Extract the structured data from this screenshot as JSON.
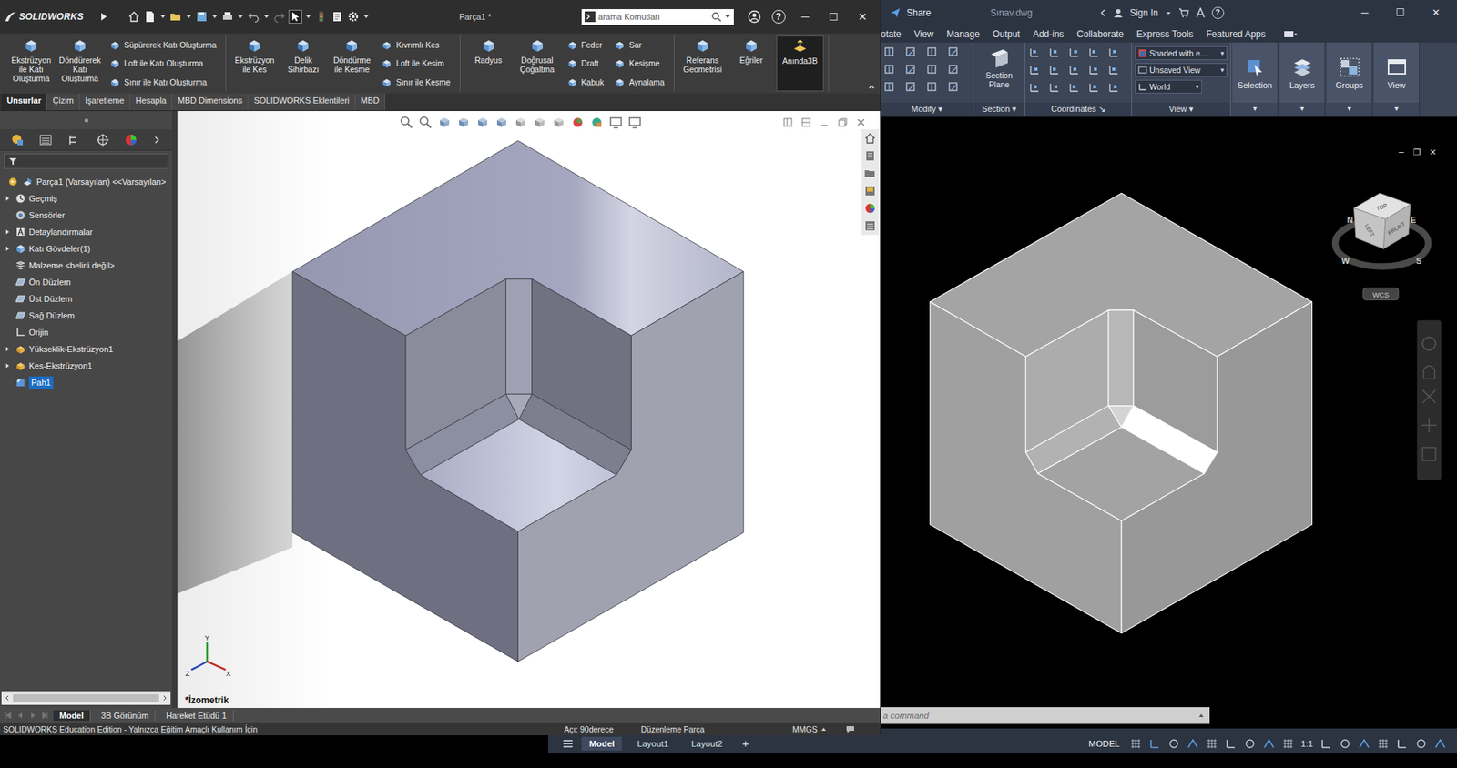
{
  "solidworks": {
    "logo": "SOLIDWORKS",
    "title": "Parça1 *",
    "search_placeholder": "arama Komutları",
    "help": "?",
    "window_controls": [
      "─",
      "☐",
      "✕"
    ],
    "ribbon_groups": [
      {
        "large": [
          {
            "label": "Ekstrüzyon ile Katı Oluşturma",
            "active": false
          },
          {
            "label": "Döndürerek Katı Oluşturma",
            "active": false
          }
        ],
        "small_columns": [
          [
            "Süpürerek Katı Oluşturma",
            "Loft ile Katı Oluşturma",
            "Sınır ile Katı Oluşturma"
          ]
        ]
      },
      {
        "large": [
          {
            "label": "Ekstrüzyon ile Kes",
            "active": false
          },
          {
            "label": "Delik Sihirbazı",
            "active": false
          },
          {
            "label": "Döndürme ile Kesme",
            "active": false
          }
        ],
        "small_columns": [
          [
            "Kıvrımlı Kes",
            "Loft ile Kesim",
            "Sınır ile Kesme"
          ]
        ]
      },
      {
        "large": [
          {
            "label": "Radyus",
            "active": false
          },
          {
            "label": "Doğrusal Çoğaltma",
            "active": false
          }
        ],
        "small_columns": [
          [
            "Feder",
            "Draft",
            "Kabuk"
          ],
          [
            "Sar",
            "Kesişme",
            "Aynalama"
          ]
        ]
      },
      {
        "large": [
          {
            "label": "Referans Geometrisi",
            "active": false
          },
          {
            "label": "Eğriler",
            "active": false
          },
          {
            "label": "Anında3B",
            "active": true
          }
        ],
        "small_columns": []
      }
    ],
    "tabs": [
      {
        "label": "Unsurlar",
        "selected": true
      },
      {
        "label": "Çizim",
        "selected": false
      },
      {
        "label": "İşaretleme",
        "selected": false
      },
      {
        "label": "Hesapla",
        "selected": false
      },
      {
        "label": "MBD Dimensions",
        "selected": false
      },
      {
        "label": "SOLIDWORKS Eklentileri",
        "selected": false
      },
      {
        "label": "MBD",
        "selected": false
      }
    ],
    "feature_tree": {
      "root": "Parça1 (Varsayılan) <<Varsayılan>",
      "items": [
        {
          "label": "Geçmiş",
          "kind": "history",
          "expandable": true,
          "selected": false
        },
        {
          "label": "Sensörler",
          "kind": "sensor",
          "expandable": false,
          "selected": false
        },
        {
          "label": "Detaylandırmalar",
          "kind": "annotation",
          "expandable": true,
          "selected": false
        },
        {
          "label": "Katı Gövdeler(1)",
          "kind": "body",
          "expandable": true,
          "selected": false
        },
        {
          "label": "Malzeme <belirli değil>",
          "kind": "material",
          "expandable": false,
          "selected": false
        },
        {
          "label": "Ön Düzlem",
          "kind": "plane",
          "expandable": false,
          "selected": false
        },
        {
          "label": "Üst Düzlem",
          "kind": "plane",
          "expandable": false,
          "selected": false
        },
        {
          "label": "Sağ Düzlem",
          "kind": "plane",
          "expandable": false,
          "selected": false
        },
        {
          "label": "Orijin",
          "kind": "origin",
          "expandable": false,
          "selected": false
        },
        {
          "label": "Yükseklik-Ekstrüzyon1",
          "kind": "feature",
          "expandable": true,
          "selected": false
        },
        {
          "label": "Kes-Ekstrüzyon1",
          "kind": "feature",
          "expandable": true,
          "selected": false
        },
        {
          "label": "Pah1",
          "kind": "chamfer",
          "expandable": false,
          "selected": true
        }
      ]
    },
    "triad": {
      "x": "X",
      "y": "Y",
      "z": "Z"
    },
    "view_label": "*İzometrik",
    "bottom_tabs": [
      {
        "label": "Model",
        "selected": true
      },
      {
        "label": "3B Görünüm",
        "selected": false
      },
      {
        "label": "Hareket Etüdü 1",
        "selected": false
      }
    ],
    "status_bar": {
      "edition": "SOLIDWORKS Education Edition - Yalnızca Eğitim Amaçlı Kullanım İçin",
      "angle": "Açı: 90derece",
      "mode": "Düzenleme Parça",
      "units": "MMGS"
    }
  },
  "autocad": {
    "title_bar": {
      "share": "Share",
      "file": "Sınav.dwg",
      "sign_in": "Sign In",
      "help": "?",
      "window_controls": [
        "─",
        "☐",
        "✕"
      ]
    },
    "menu_tabs": [
      {
        "label": "otate",
        "selected": false
      },
      {
        "label": "View",
        "selected": false
      },
      {
        "label": "Manage",
        "selected": false
      },
      {
        "label": "Output",
        "selected": false
      },
      {
        "label": "Add-ins",
        "selected": false
      },
      {
        "label": "Collaborate",
        "selected": false
      },
      {
        "label": "Express Tools",
        "selected": false
      },
      {
        "label": "Featured Apps",
        "selected": false
      }
    ],
    "ribbon": {
      "panels": [
        "Modify",
        "Section",
        "Coordinates",
        "View"
      ],
      "section_plane": "Section Plane",
      "visual_style": "Shaded with e...",
      "named_view": "Unsaved View",
      "ucs": "World",
      "large": [
        "Selection",
        "Layers",
        "Groups",
        "View"
      ]
    },
    "viewport_controls": [
      "─",
      "❐",
      "✕"
    ],
    "viewcube": {
      "top": "TOP",
      "left": "LEFT",
      "front": "FRONT",
      "compass": [
        "N",
        "E",
        "S",
        "W"
      ],
      "wcs": "WCS"
    },
    "command_line": {
      "placeholder": "a command"
    },
    "layout_tabs": [
      {
        "label": "Model",
        "selected": true
      },
      {
        "label": "Layout1",
        "selected": false
      },
      {
        "label": "Layout2",
        "selected": false
      }
    ],
    "add_layout": "+",
    "status_bar": {
      "space": "MODEL",
      "scale": "1:1"
    }
  }
}
